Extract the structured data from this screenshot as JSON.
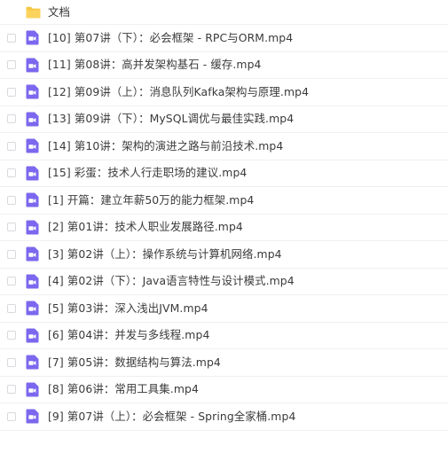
{
  "folder": {
    "name": "文档",
    "icon": "folder-icon",
    "icon_color": "#f7c744"
  },
  "files": [
    {
      "name": "[10] 第07讲（下）：必会框架 - RPC与ORM.mp4",
      "icon": "video-file-icon"
    },
    {
      "name": "[11] 第08讲：高并发架构基石 - 缓存.mp4",
      "icon": "video-file-icon"
    },
    {
      "name": "[12] 第09讲（上）：消息队列Kafka架构与原理.mp4",
      "icon": "video-file-icon"
    },
    {
      "name": "[13] 第09讲（下）：MySQL调优与最佳实践.mp4",
      "icon": "video-file-icon"
    },
    {
      "name": "[14] 第10讲：架构的演进之路与前沿技术.mp4",
      "icon": "video-file-icon"
    },
    {
      "name": "[15] 彩蛋：技术人行走职场的建议.mp4",
      "icon": "video-file-icon"
    },
    {
      "name": "[1] 开篇：建立年薪50万的能力框架.mp4",
      "icon": "video-file-icon"
    },
    {
      "name": "[2] 第01讲：技术人职业发展路径.mp4",
      "icon": "video-file-icon"
    },
    {
      "name": "[3] 第02讲（上）：操作系统与计算机网络.mp4",
      "icon": "video-file-icon"
    },
    {
      "name": "[4] 第02讲（下）：Java语言特性与设计模式.mp4",
      "icon": "video-file-icon"
    },
    {
      "name": "[5] 第03讲：深入浅出JVM.mp4",
      "icon": "video-file-icon"
    },
    {
      "name": "[6] 第04讲：并发与多线程.mp4",
      "icon": "video-file-icon"
    },
    {
      "name": "[7] 第05讲：数据结构与算法.mp4",
      "icon": "video-file-icon"
    },
    {
      "name": "[8] 第06讲：常用工具集.mp4",
      "icon": "video-file-icon"
    },
    {
      "name": "[9] 第07讲（上）：必会框架 - Spring全家桶.mp4",
      "icon": "video-file-icon"
    }
  ],
  "colors": {
    "video_icon": "#7b68ee",
    "text": "#3a3a3a",
    "divider": "#f0f0f2"
  }
}
